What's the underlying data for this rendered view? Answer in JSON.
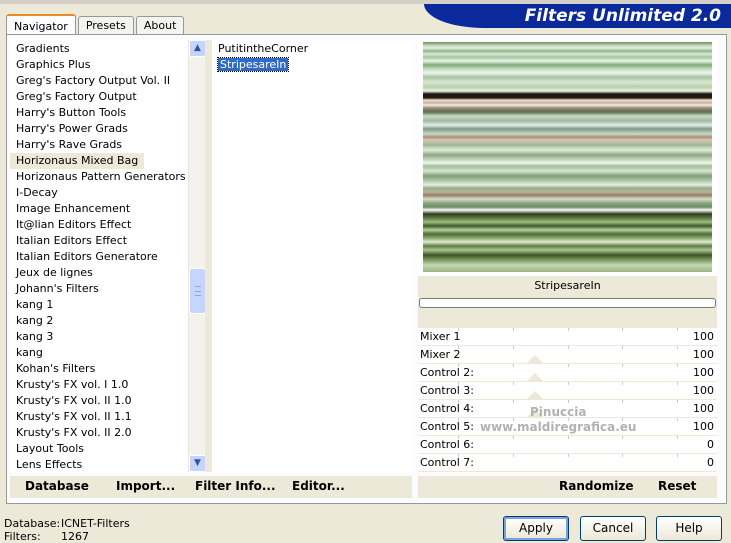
{
  "tabs": [
    {
      "label": "Navigator",
      "active": true
    },
    {
      "label": "Presets",
      "active": false
    },
    {
      "label": "About",
      "active": false
    }
  ],
  "banner": {
    "title": "Filters Unlimited 2.0"
  },
  "categories": [
    "Gradients",
    "Graphics Plus",
    "Greg's Factory Output Vol. II",
    "Greg's Factory Output",
    "Harry's Button Tools",
    "Harry's Power Grads",
    "Harry's Rave Grads",
    "Horizonaus Mixed Bag",
    "Horizonaus Pattern Generators",
    "I-Decay",
    "Image Enhancement",
    "It@lian Editors Effect",
    "Italian Editors Effect",
    "Italian Editors Generatore",
    "Jeux de lignes",
    "Johann's Filters",
    "kang 1",
    "kang 2",
    "kang 3",
    "kang",
    "Kohan's Filters",
    "Krusty's FX vol. I 1.0",
    "Krusty's FX vol. II 1.0",
    "Krusty's FX vol. II 1.1",
    "Krusty's FX vol. II 2.0",
    "Layout Tools",
    "Lens Effects"
  ],
  "selected_category": "Horizonaus Mixed Bag",
  "filters": [
    "PutitintheCorner",
    "StripesareIn"
  ],
  "selected_filter": "StripesareIn",
  "filter_title": "StripesareIn",
  "controls": [
    {
      "label": "Mixer 1",
      "value": "100"
    },
    {
      "label": "Mixer 2",
      "value": "100"
    },
    {
      "label": "Control 2:",
      "value": "100"
    },
    {
      "label": "Control 3:",
      "value": "100"
    },
    {
      "label": "Control 4:",
      "value": "100"
    },
    {
      "label": "Control 5:",
      "value": "100"
    },
    {
      "label": "Control 6:",
      "value": "0"
    },
    {
      "label": "Control 7:",
      "value": "0"
    }
  ],
  "watermark": {
    "line1": "Pinuccia",
    "line2": "www.maldiregrafica.eu"
  },
  "toolbar": {
    "database": "Database",
    "import": "Import...",
    "filter_info": "Filter Info...",
    "editor": "Editor...",
    "randomize": "Randomize",
    "reset": "Reset"
  },
  "status": {
    "database_label": "Database:",
    "database_value": "ICNET-Filters",
    "filters_label": "Filters:",
    "filters_value": "1267"
  },
  "buttons": {
    "apply": "Apply",
    "cancel": "Cancel",
    "help": "Help"
  },
  "icons": {
    "scroll_up": "chevron-up-icon",
    "scroll_down": "chevron-down-icon"
  }
}
